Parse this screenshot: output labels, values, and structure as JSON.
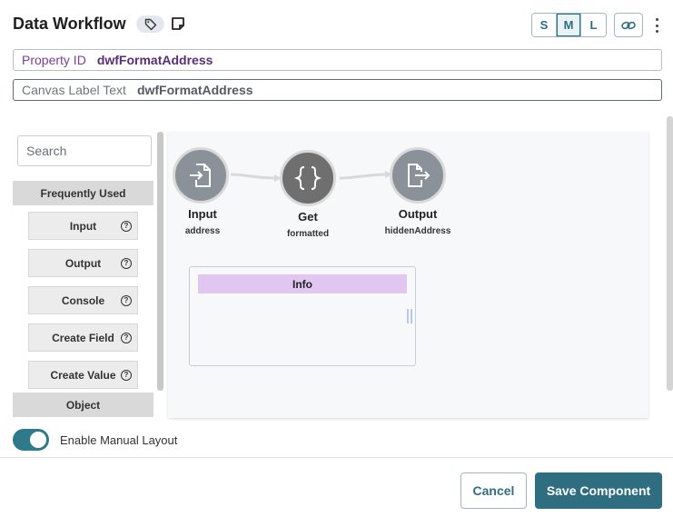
{
  "header": {
    "title": "Data Workflow",
    "sizes": [
      "S",
      "M",
      "L"
    ],
    "active_size": "M"
  },
  "fields": {
    "property_id_label": "Property ID",
    "property_id_value": "dwfFormatAddress",
    "canvas_label_label": "Canvas Label Text",
    "canvas_label_value": "dwfFormatAddress"
  },
  "panel": {
    "search_placeholder": "Search",
    "frequently_used": "Frequently Used",
    "items": [
      "Input",
      "Output",
      "Console",
      "Create Field",
      "Create Value"
    ],
    "object_header": "Object"
  },
  "canvas": {
    "nodes": [
      {
        "label": "Input",
        "sub": "address",
        "icon": "file-import-icon"
      },
      {
        "label": "Get",
        "sub": "formatted",
        "icon": "curly-braces-icon"
      },
      {
        "label": "Output",
        "sub": "hiddenAddress",
        "icon": "file-export-icon"
      }
    ],
    "info_title": "Info"
  },
  "footer": {
    "toggle_label": "Enable Manual Layout",
    "toggle_on": true,
    "cancel": "Cancel",
    "save": "Save Component"
  },
  "colors": {
    "accent": "#2f6d80",
    "info_header": "#e2c6f2",
    "property_text": "#7d3c98"
  }
}
